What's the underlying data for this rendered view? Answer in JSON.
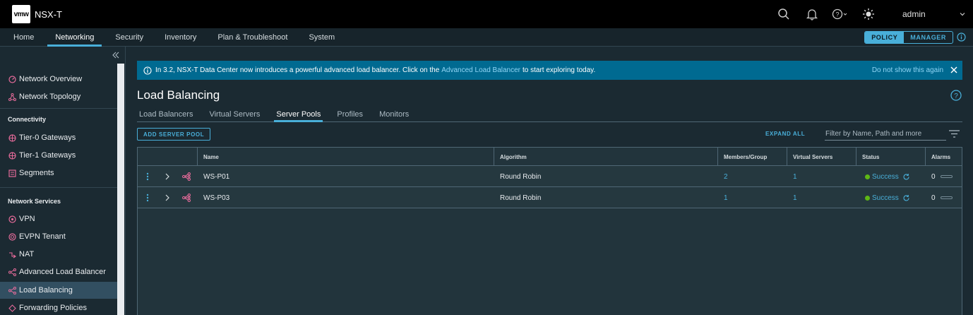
{
  "header": {
    "logo_text": "vmw",
    "product": "NSX-T",
    "user": "admin"
  },
  "nav": {
    "tabs": [
      "Home",
      "Networking",
      "Security",
      "Inventory",
      "Plan & Troubleshoot",
      "System"
    ],
    "active_tab": "Networking",
    "mode": {
      "policy": "POLICY",
      "manager": "MANAGER",
      "active": "POLICY"
    }
  },
  "sidebar": {
    "items_top": [
      {
        "label": "Network Overview",
        "icon": "network-overview-icon"
      },
      {
        "label": "Network Topology",
        "icon": "network-topology-icon"
      }
    ],
    "section_connectivity": "Connectivity",
    "items_connectivity": [
      {
        "label": "Tier-0 Gateways",
        "icon": "tier0-gateway-icon"
      },
      {
        "label": "Tier-1 Gateways",
        "icon": "tier1-gateway-icon"
      },
      {
        "label": "Segments",
        "icon": "segments-icon"
      }
    ],
    "section_services": "Network Services",
    "items_services": [
      {
        "label": "VPN",
        "icon": "vpn-icon"
      },
      {
        "label": "EVPN Tenant",
        "icon": "evpn-tenant-icon"
      },
      {
        "label": "NAT",
        "icon": "nat-icon"
      },
      {
        "label": "Advanced Load Balancer",
        "icon": "advanced-load-balancer-icon"
      },
      {
        "label": "Load Balancing",
        "icon": "load-balancing-icon",
        "active": true
      },
      {
        "label": "Forwarding Policies",
        "icon": "forwarding-policies-icon"
      }
    ]
  },
  "banner": {
    "text_before": "In 3.2, NSX-T Data Center now introduces a powerful advanced load balancer. Click on the",
    "link": "Advanced Load Balancer",
    "text_after": "to start exploring today.",
    "dismiss": "Do not show this again"
  },
  "page": {
    "title": "Load Balancing",
    "tabs": [
      "Load Balancers",
      "Virtual Servers",
      "Server Pools",
      "Profiles",
      "Monitors"
    ],
    "active_tab": "Server Pools",
    "add_button": "ADD SERVER POOL",
    "expand_all": "EXPAND ALL",
    "filter_placeholder": "Filter by Name, Path and more"
  },
  "grid": {
    "columns": [
      "Name",
      "Algorithm",
      "Members/Group",
      "Virtual Servers",
      "Status",
      "Alarms"
    ],
    "rows": [
      {
        "name": "WS-P01",
        "algorithm": "Round Robin",
        "members": "2",
        "virtual_servers": "1",
        "status": "Success",
        "alarms": "0"
      },
      {
        "name": "WS-P03",
        "algorithm": "Round Robin",
        "members": "1",
        "virtual_servers": "1",
        "status": "Success",
        "alarms": "0"
      }
    ]
  },
  "colors": {
    "accent": "#49afd9",
    "banner": "#006a91",
    "success": "#5eb715",
    "icon_pink": "#e66b9a"
  }
}
